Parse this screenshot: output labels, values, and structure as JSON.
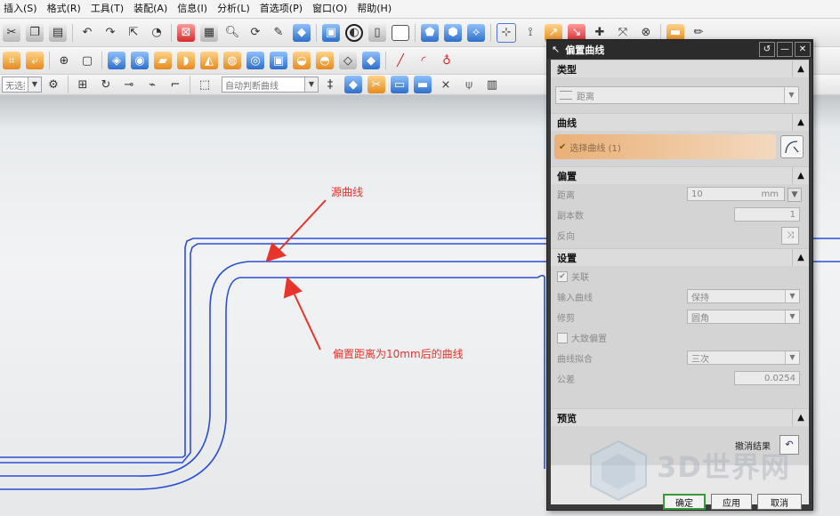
{
  "menu": [
    "插入(S)",
    "格式(R)",
    "工具(T)",
    "装配(A)",
    "信息(I)",
    "分析(L)",
    "首选项(P)",
    "窗口(O)",
    "帮助(H)"
  ],
  "toolbar3": {
    "filter_value": "无选择过滤",
    "curve_rule_value": "自动判断曲线"
  },
  "annotations": {
    "source_curve": "源曲线",
    "offset_curve": "偏置距离为10mm后的曲线"
  },
  "dialog": {
    "title": "偏置曲线",
    "type_section": "类型",
    "type_value": "距离",
    "curve_section": "曲线",
    "select_curve_label": "选择曲线 (1)",
    "offset_section": "偏置",
    "distance_label": "距离",
    "distance_value": "10",
    "distance_unit": "mm",
    "copies_label": "副本数",
    "copies_value": "1",
    "reverse_label": "反向",
    "settings_section": "设置",
    "associative_label": "关联",
    "input_curve_label": "输入曲线",
    "input_curve_value": "保持",
    "trim_label": "修剪",
    "trim_value": "圆角",
    "large_offset_label": "大致偏置",
    "curve_fit_label": "曲线拟合",
    "curve_fit_value": "三次",
    "tolerance_label": "公差",
    "tolerance_value": "0.0254",
    "preview_section": "预览",
    "undo_result_label": "撤消结果",
    "ok_label": "确定",
    "apply_label": "应用",
    "cancel_label": "取消"
  },
  "watermark": "3D世界网",
  "colors": {
    "curve": "#2a4fd6",
    "annotation": "#e8352c",
    "select_highlight": "#eab077"
  }
}
